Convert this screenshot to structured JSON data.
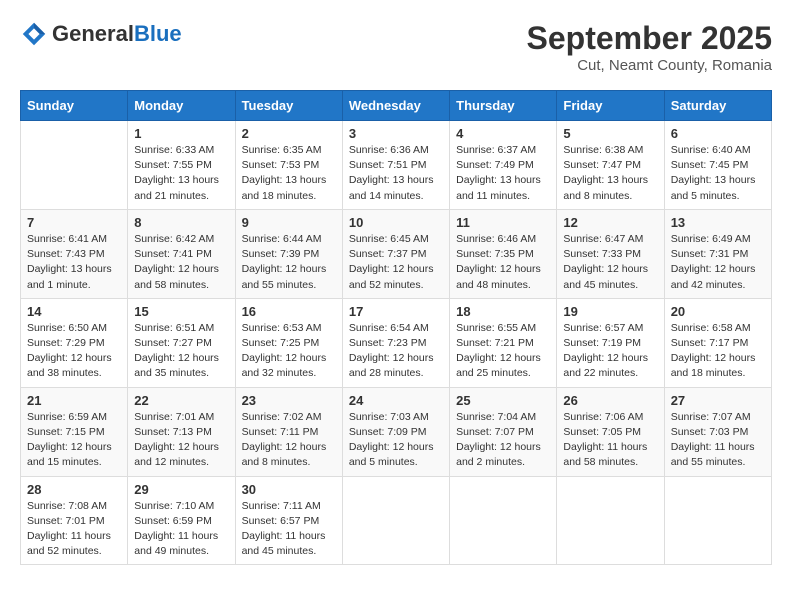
{
  "header": {
    "logo_general": "General",
    "logo_blue": "Blue",
    "month_title": "September 2025",
    "subtitle": "Cut, Neamt County, Romania"
  },
  "days_of_week": [
    "Sunday",
    "Monday",
    "Tuesday",
    "Wednesday",
    "Thursday",
    "Friday",
    "Saturday"
  ],
  "weeks": [
    [
      {
        "day": "",
        "info": ""
      },
      {
        "day": "1",
        "info": "Sunrise: 6:33 AM\nSunset: 7:55 PM\nDaylight: 13 hours\nand 21 minutes."
      },
      {
        "day": "2",
        "info": "Sunrise: 6:35 AM\nSunset: 7:53 PM\nDaylight: 13 hours\nand 18 minutes."
      },
      {
        "day": "3",
        "info": "Sunrise: 6:36 AM\nSunset: 7:51 PM\nDaylight: 13 hours\nand 14 minutes."
      },
      {
        "day": "4",
        "info": "Sunrise: 6:37 AM\nSunset: 7:49 PM\nDaylight: 13 hours\nand 11 minutes."
      },
      {
        "day": "5",
        "info": "Sunrise: 6:38 AM\nSunset: 7:47 PM\nDaylight: 13 hours\nand 8 minutes."
      },
      {
        "day": "6",
        "info": "Sunrise: 6:40 AM\nSunset: 7:45 PM\nDaylight: 13 hours\nand 5 minutes."
      }
    ],
    [
      {
        "day": "7",
        "info": "Sunrise: 6:41 AM\nSunset: 7:43 PM\nDaylight: 13 hours\nand 1 minute."
      },
      {
        "day": "8",
        "info": "Sunrise: 6:42 AM\nSunset: 7:41 PM\nDaylight: 12 hours\nand 58 minutes."
      },
      {
        "day": "9",
        "info": "Sunrise: 6:44 AM\nSunset: 7:39 PM\nDaylight: 12 hours\nand 55 minutes."
      },
      {
        "day": "10",
        "info": "Sunrise: 6:45 AM\nSunset: 7:37 PM\nDaylight: 12 hours\nand 52 minutes."
      },
      {
        "day": "11",
        "info": "Sunrise: 6:46 AM\nSunset: 7:35 PM\nDaylight: 12 hours\nand 48 minutes."
      },
      {
        "day": "12",
        "info": "Sunrise: 6:47 AM\nSunset: 7:33 PM\nDaylight: 12 hours\nand 45 minutes."
      },
      {
        "day": "13",
        "info": "Sunrise: 6:49 AM\nSunset: 7:31 PM\nDaylight: 12 hours\nand 42 minutes."
      }
    ],
    [
      {
        "day": "14",
        "info": "Sunrise: 6:50 AM\nSunset: 7:29 PM\nDaylight: 12 hours\nand 38 minutes."
      },
      {
        "day": "15",
        "info": "Sunrise: 6:51 AM\nSunset: 7:27 PM\nDaylight: 12 hours\nand 35 minutes."
      },
      {
        "day": "16",
        "info": "Sunrise: 6:53 AM\nSunset: 7:25 PM\nDaylight: 12 hours\nand 32 minutes."
      },
      {
        "day": "17",
        "info": "Sunrise: 6:54 AM\nSunset: 7:23 PM\nDaylight: 12 hours\nand 28 minutes."
      },
      {
        "day": "18",
        "info": "Sunrise: 6:55 AM\nSunset: 7:21 PM\nDaylight: 12 hours\nand 25 minutes."
      },
      {
        "day": "19",
        "info": "Sunrise: 6:57 AM\nSunset: 7:19 PM\nDaylight: 12 hours\nand 22 minutes."
      },
      {
        "day": "20",
        "info": "Sunrise: 6:58 AM\nSunset: 7:17 PM\nDaylight: 12 hours\nand 18 minutes."
      }
    ],
    [
      {
        "day": "21",
        "info": "Sunrise: 6:59 AM\nSunset: 7:15 PM\nDaylight: 12 hours\nand 15 minutes."
      },
      {
        "day": "22",
        "info": "Sunrise: 7:01 AM\nSunset: 7:13 PM\nDaylight: 12 hours\nand 12 minutes."
      },
      {
        "day": "23",
        "info": "Sunrise: 7:02 AM\nSunset: 7:11 PM\nDaylight: 12 hours\nand 8 minutes."
      },
      {
        "day": "24",
        "info": "Sunrise: 7:03 AM\nSunset: 7:09 PM\nDaylight: 12 hours\nand 5 minutes."
      },
      {
        "day": "25",
        "info": "Sunrise: 7:04 AM\nSunset: 7:07 PM\nDaylight: 12 hours\nand 2 minutes."
      },
      {
        "day": "26",
        "info": "Sunrise: 7:06 AM\nSunset: 7:05 PM\nDaylight: 11 hours\nand 58 minutes."
      },
      {
        "day": "27",
        "info": "Sunrise: 7:07 AM\nSunset: 7:03 PM\nDaylight: 11 hours\nand 55 minutes."
      }
    ],
    [
      {
        "day": "28",
        "info": "Sunrise: 7:08 AM\nSunset: 7:01 PM\nDaylight: 11 hours\nand 52 minutes."
      },
      {
        "day": "29",
        "info": "Sunrise: 7:10 AM\nSunset: 6:59 PM\nDaylight: 11 hours\nand 49 minutes."
      },
      {
        "day": "30",
        "info": "Sunrise: 7:11 AM\nSunset: 6:57 PM\nDaylight: 11 hours\nand 45 minutes."
      },
      {
        "day": "",
        "info": ""
      },
      {
        "day": "",
        "info": ""
      },
      {
        "day": "",
        "info": ""
      },
      {
        "day": "",
        "info": ""
      }
    ]
  ]
}
